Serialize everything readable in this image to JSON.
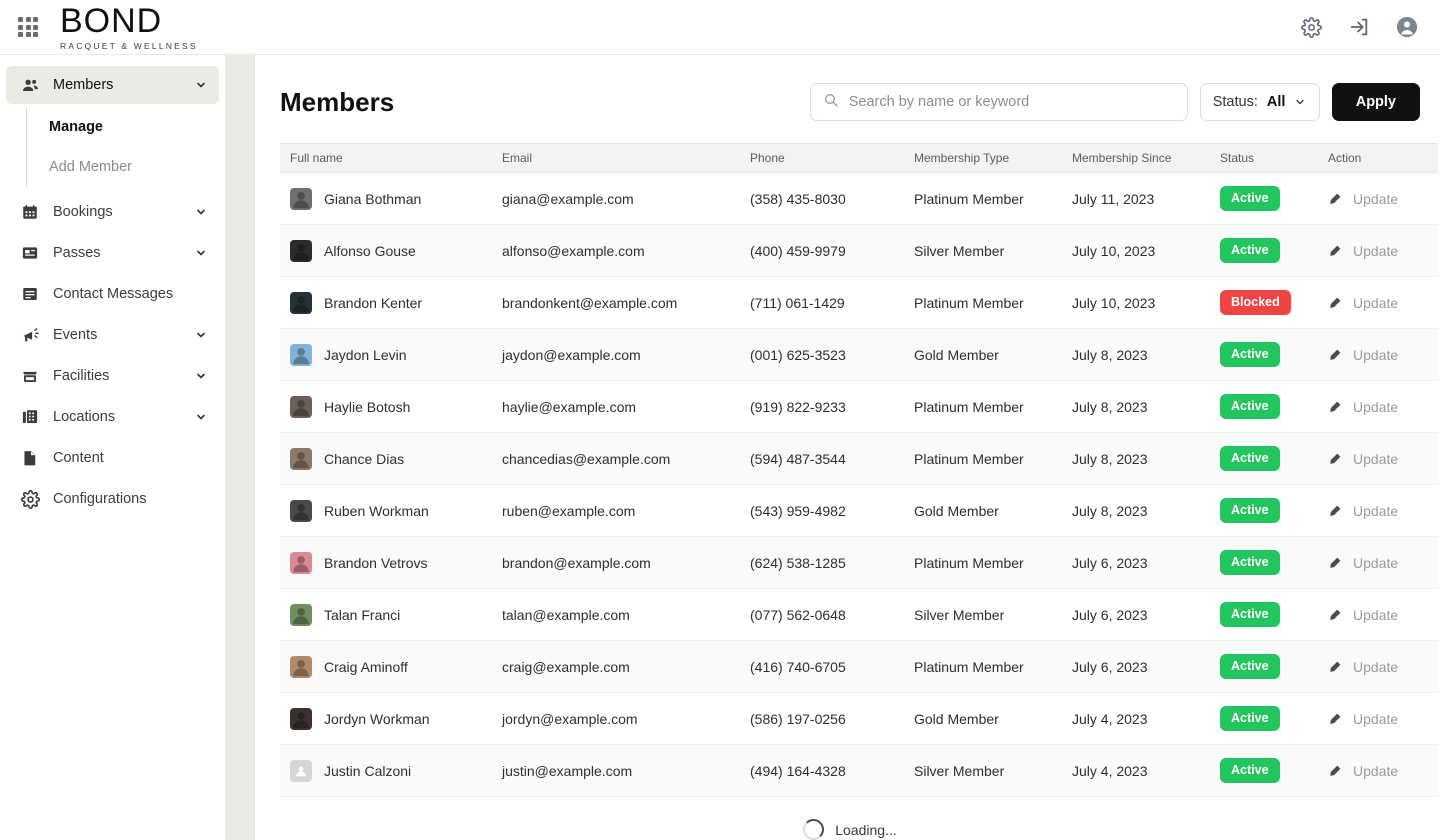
{
  "topbar": {
    "apps_icon": "apps-grid-icon",
    "brand": {
      "name": "BOND",
      "tagline": "RACQUET & WELLNESS"
    },
    "icons": [
      {
        "name": "settings-icon",
        "label": "Settings"
      },
      {
        "name": "login-icon",
        "label": "Sign in"
      },
      {
        "name": "account-avatar-icon",
        "label": "Account"
      }
    ]
  },
  "sidebar": {
    "items": [
      {
        "label": "Members",
        "icon": "members-icon",
        "active": true,
        "expandable": true
      },
      {
        "label": "Bookings",
        "icon": "calendar-icon",
        "active": false,
        "expandable": true
      },
      {
        "label": "Passes",
        "icon": "pass-card-icon",
        "active": false,
        "expandable": true
      },
      {
        "label": "Contact Messages",
        "icon": "message-icon",
        "active": false,
        "expandable": false
      },
      {
        "label": "Events",
        "icon": "megaphone-icon",
        "active": false,
        "expandable": true
      },
      {
        "label": "Facilities",
        "icon": "store-icon",
        "active": false,
        "expandable": true
      },
      {
        "label": "Locations",
        "icon": "building-icon",
        "active": false,
        "expandable": true
      },
      {
        "label": "Content",
        "icon": "document-icon",
        "active": false,
        "expandable": false
      },
      {
        "label": "Configurations",
        "icon": "gear-icon",
        "active": false,
        "expandable": false
      }
    ],
    "submenu": [
      {
        "label": "Manage",
        "active": true
      },
      {
        "label": "Add Member",
        "active": false
      }
    ]
  },
  "page": {
    "title": "Members",
    "search": {
      "value": "",
      "placeholder": "Search by name or keyword",
      "icon": "search-icon"
    },
    "status_filter": {
      "label": "Status:",
      "value": "All",
      "icon": "chevron-down-icon"
    },
    "apply_label": "Apply"
  },
  "table": {
    "columns": [
      "Full name",
      "Email",
      "Phone",
      "Membership Type",
      "Membership Since",
      "Status",
      "Action"
    ],
    "action_label": "Update",
    "action_icon": "pencil-icon",
    "rows": [
      {
        "name": "Giana Bothman",
        "email": "giana@example.com",
        "phone": "(358) 435-8030",
        "type": "Platinum Member",
        "since": "July 11, 2023",
        "status": "Active",
        "avatar": "#6f6f6f"
      },
      {
        "name": "Alfonso Gouse",
        "email": "alfonso@example.com",
        "phone": "(400) 459-9979",
        "type": "Silver Member",
        "since": "July 10, 2023",
        "status": "Active",
        "avatar": "#2b2b2b"
      },
      {
        "name": "Brandon Kenter",
        "email": "brandonkent@example.com",
        "phone": "(711) 061-1429",
        "type": "Platinum Member",
        "since": "July 10, 2023",
        "status": "Blocked",
        "avatar": "#27313a"
      },
      {
        "name": "Jaydon Levin",
        "email": "jaydon@example.com",
        "phone": "(001) 625-3523",
        "type": "Gold Member",
        "since": "July 8, 2023",
        "status": "Active",
        "avatar": "#7fb4d4"
      },
      {
        "name": "Haylie Botosh",
        "email": "haylie@example.com",
        "phone": "(919) 822-9233",
        "type": "Platinum Member",
        "since": "July 8, 2023",
        "status": "Active",
        "avatar": "#6b5f58"
      },
      {
        "name": "Chance Dias",
        "email": "chancedias@example.com",
        "phone": "(594) 487-3544",
        "type": "Platinum Member",
        "since": "July 8, 2023",
        "status": "Active",
        "avatar": "#8b7a6b"
      },
      {
        "name": "Ruben Workman",
        "email": "ruben@example.com",
        "phone": "(543) 959-4982",
        "type": "Gold Member",
        "since": "July 8, 2023",
        "status": "Active",
        "avatar": "#4a4a4a"
      },
      {
        "name": "Brandon Vetrovs",
        "email": "brandon@example.com",
        "phone": "(624) 538-1285",
        "type": "Platinum Member",
        "since": "July 6, 2023",
        "status": "Active",
        "avatar": "#d98a96"
      },
      {
        "name": "Talan Franci",
        "email": "talan@example.com",
        "phone": "(077) 562-0648",
        "type": "Silver Member",
        "since": "July 6, 2023",
        "status": "Active",
        "avatar": "#6f8f5e"
      },
      {
        "name": "Craig Aminoff",
        "email": "craig@example.com",
        "phone": "(416) 740-6705",
        "type": "Platinum Member",
        "since": "July 6, 2023",
        "status": "Active",
        "avatar": "#b08a6a"
      },
      {
        "name": "Jordyn Workman",
        "email": "jordyn@example.com",
        "phone": "(586) 197-0256",
        "type": "Gold Member",
        "since": "July 4, 2023",
        "status": "Active",
        "avatar": "#3a3230"
      },
      {
        "name": "Justin Calzoni",
        "email": "justin@example.com",
        "phone": "(494) 164-4328",
        "type": "Silver Member",
        "since": "July 4, 2023",
        "status": "Active",
        "avatar": "#d6d6d6",
        "placeholder": true
      }
    ]
  },
  "footer": {
    "loading_text": "Loading...",
    "spinner_icon": "spinner-icon"
  },
  "colors": {
    "active_badge": "#22c55e",
    "blocked_badge": "#ef4444",
    "apply_button": "#111111",
    "sidebar_active": "#eceae4"
  }
}
